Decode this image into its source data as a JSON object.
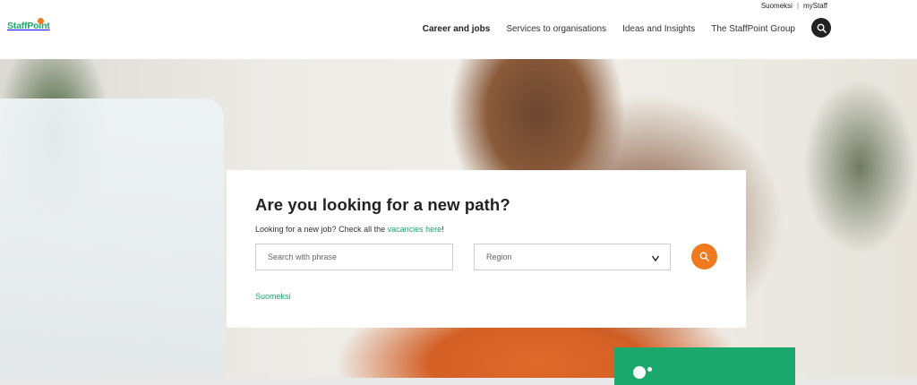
{
  "utility": {
    "lang": "Suomeksi",
    "separator": "|",
    "account": "myStaff"
  },
  "logo": {
    "text": "StaffPoint"
  },
  "nav": {
    "items": [
      {
        "label": "Career and jobs",
        "active": true
      },
      {
        "label": "Services to organisations",
        "active": false
      },
      {
        "label": "Ideas and Insights",
        "active": false
      },
      {
        "label": "The StaffPoint Group",
        "active": false
      }
    ],
    "search_icon": "search-icon"
  },
  "hero_card": {
    "title": "Are you looking for a new path?",
    "subtitle_before": "Looking for a new job? Check all the ",
    "subtitle_link": "vacancies here",
    "subtitle_after": "!",
    "search_placeholder": "Search with phrase",
    "region_value": "Region",
    "region_chevron": "v",
    "lang_link": "Suomeksi"
  },
  "colors": {
    "brand_green": "#1ba86c",
    "accent_orange": "#f07a1e",
    "dark": "#222222"
  }
}
